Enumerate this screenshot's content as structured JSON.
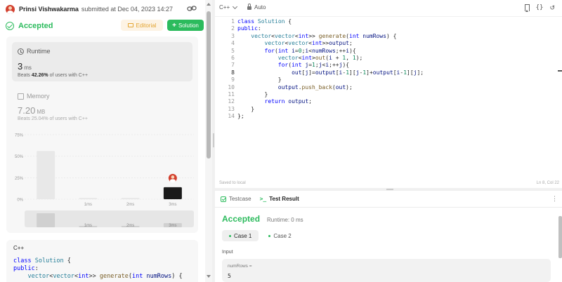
{
  "submission": {
    "user": "Prinsi Vishwakarma",
    "submitted_text": "submitted at Dec 04, 2023 14:27",
    "status": "Accepted",
    "editorial_label": "Editorial",
    "solution_label": "Solution"
  },
  "runtime": {
    "label": "Runtime",
    "value": "3",
    "unit": "ms",
    "beats_prefix": "Beats",
    "beats_pct": "42.26%",
    "beats_suffix": "of users with C++"
  },
  "memory": {
    "label": "Memory",
    "value": "7.20",
    "unit": "MB",
    "beats_text": "Beats 25.04% of users with C++"
  },
  "chart_data": {
    "type": "bar",
    "categories": [
      "",
      "1ms",
      "2ms",
      "3ms"
    ],
    "values": [
      56,
      1.5,
      1.5,
      14
    ],
    "highlight_index": 3,
    "ylim": [
      0,
      75
    ],
    "yticks": [
      "75%",
      "50%",
      "25%",
      "0%"
    ],
    "ytick_values": [
      75,
      50,
      25,
      0
    ],
    "grid": true,
    "colors": {
      "bar": "#e8e8e8",
      "highlight": "#1a1a1a"
    }
  },
  "code_preview": {
    "lang": "C++",
    "lines": [
      "class Solution {",
      "public:",
      "    vector<vector<int>> generate(int numRows) {"
    ]
  },
  "editor": {
    "lang": "C++",
    "mode": "Auto",
    "saved_text": "Saved to local",
    "cursor_pos": "Ln 8, Col 22",
    "line_numbers": [
      "1",
      "2",
      "3",
      "4",
      "5",
      "6",
      "7",
      "8",
      "9",
      "10",
      "11",
      "12",
      "13",
      "14"
    ],
    "lines": [
      "class Solution {",
      "public:",
      "    vector<vector<int>> generate(int numRows) {",
      "        vector<vector<int>>output;",
      "        for(int i=0;i<numRows;++i){",
      "            vector<int>out(i + 1, 1);",
      "            for(int j=1;j<i;++j){",
      "                out[j]=output[i-1][j-1]+output[i-1][j];",
      "            }",
      "            output.push_back(out);",
      "        }",
      "        return output;",
      "    }",
      "};"
    ]
  },
  "test_panel": {
    "tab_testcase": "Testcase",
    "tab_result": "Test Result",
    "result_title": "Accepted",
    "result_runtime": "Runtime: 0 ms",
    "case1": "Case 1",
    "case2": "Case 2",
    "input_label": "Input",
    "input_var": "numRows =",
    "input_value": "5"
  },
  "colors": {
    "accent_green": "#2cbb5d",
    "editorial_orange": "#e3a533"
  }
}
